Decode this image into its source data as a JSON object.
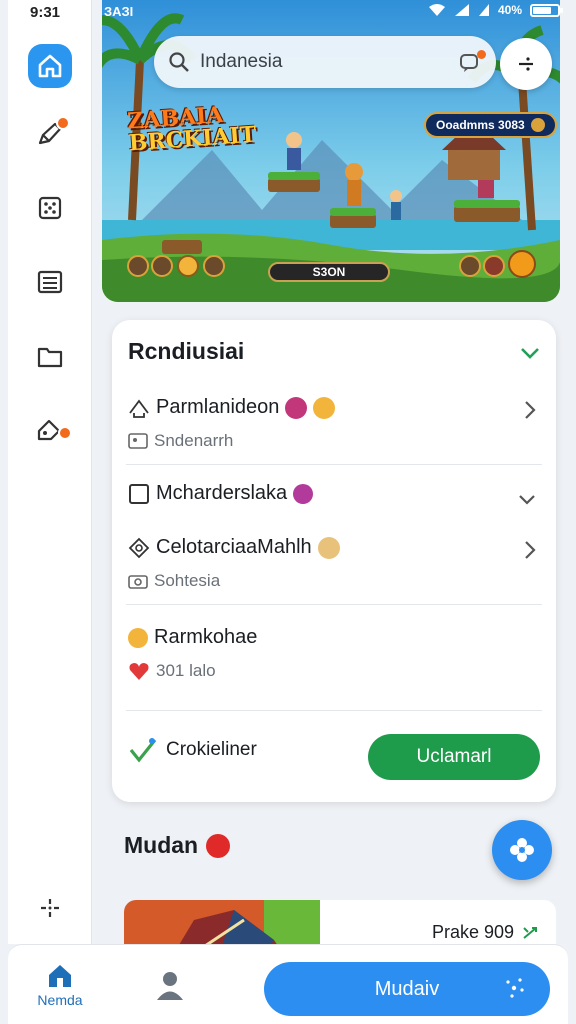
{
  "status_bar": {
    "time": "9:31",
    "carrier": "ЗАЗI",
    "network": "40%"
  },
  "colors": {
    "accent_blue": "#2b8ef0",
    "accent_green": "#1f9b4c",
    "badge_orange": "#f26b1d"
  },
  "sidebar": {
    "items": [
      {
        "name": "home",
        "icon": "home-icon",
        "active": true
      },
      {
        "name": "edit",
        "icon": "pencil-icon",
        "badge": true
      },
      {
        "name": "dice",
        "icon": "dice-icon"
      },
      {
        "name": "list",
        "icon": "list-icon"
      },
      {
        "name": "folder",
        "icon": "folder-icon"
      },
      {
        "name": "tag",
        "icon": "tag-icon",
        "badge": true
      }
    ]
  },
  "hero": {
    "search_placeholder": "Indanesia",
    "logo_line1": "ZABAIA",
    "logo_line2": "BRCKIAIT",
    "chip_text": "Ooadmms 3083",
    "pill_text": "S3ON"
  },
  "main_card": {
    "header": "Rcndiusiai",
    "rows": [
      {
        "title": "Parmlanideon",
        "subtitle": "Sndenarrh"
      },
      {
        "title": "Mcharderslaka"
      },
      {
        "title": "CelotarciaaMahlh",
        "subtitle": "Sohtesia"
      },
      {
        "title": "Rarmkohae",
        "subtitle": "301 lalo"
      }
    ],
    "footer_label": "Crokieliner",
    "cta_label": "Uclamarl"
  },
  "section": {
    "title": "Mudan"
  },
  "preview": {
    "label": "Prake 909"
  },
  "bottom_nav": {
    "home_label": "Nemda",
    "primary_label": "Mudaiv"
  }
}
